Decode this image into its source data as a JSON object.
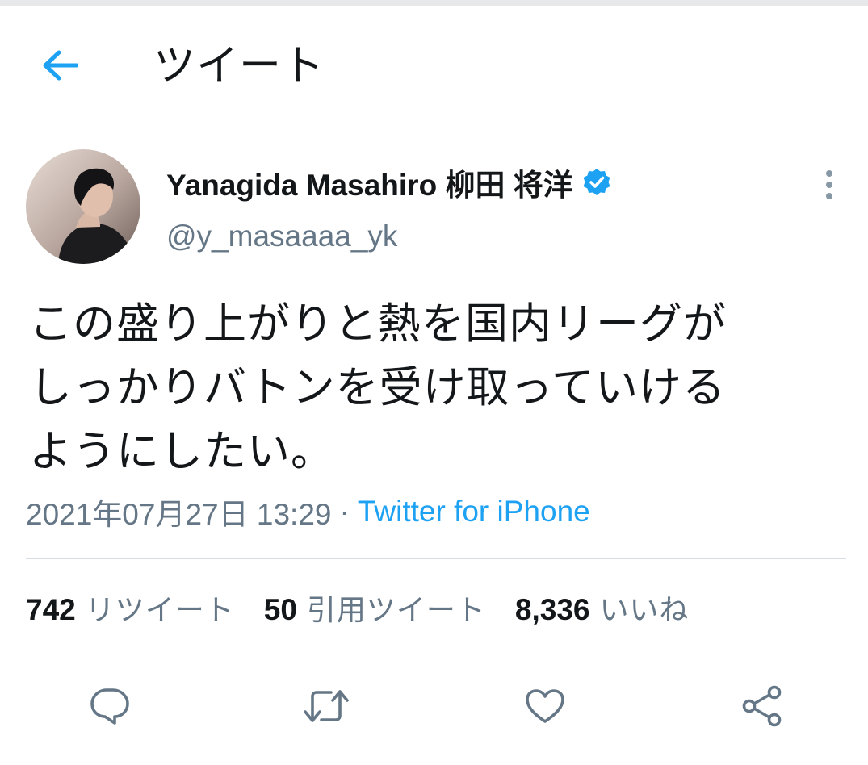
{
  "header": {
    "back_icon": "arrow-left-icon",
    "title": "ツイート"
  },
  "tweet": {
    "display_name": "Yanagida Masahiro 柳田 将洋",
    "verified_icon": "verified-badge-icon",
    "handle": "@y_masaaaa_yk",
    "more_icon": "more-vertical-icon",
    "text": "この盛り上がりと熱を国内リーグが\nしっかりバトンを受け取っていける\nようにしたい。",
    "timestamp": "2021年07月27日 13:29",
    "separator": "·",
    "source": "Twitter for iPhone"
  },
  "stats": {
    "retweets_count": "742",
    "retweets_label": "リツイート",
    "quotes_count": "50",
    "quotes_label": "引用ツイート",
    "likes_count": "8,336",
    "likes_label": "いいね"
  },
  "actions": {
    "reply_icon": "reply-icon",
    "retweet_icon": "retweet-icon",
    "like_icon": "heart-icon",
    "share_icon": "share-icon"
  },
  "colors": {
    "accent": "#1da1f2",
    "secondary_text": "#657786",
    "primary_text": "#14171a",
    "divider": "#d8dde1"
  }
}
